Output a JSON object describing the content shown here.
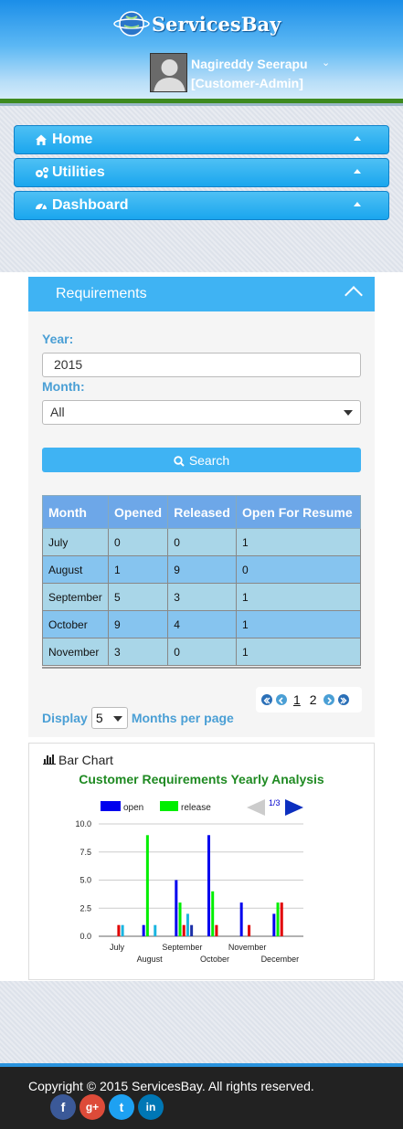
{
  "header": {
    "brand": "ServicesBay",
    "user_name": "Nagireddy Seerapu",
    "user_role": "[Customer-Admin]"
  },
  "nav": {
    "items": [
      {
        "label": "Home",
        "icon": "home-icon"
      },
      {
        "label": "Utilities",
        "icon": "cogs-icon"
      },
      {
        "label": "Dashboard",
        "icon": "dashboard-icon"
      }
    ]
  },
  "requirements": {
    "title": "Requirements",
    "year_label": "Year:",
    "year_value": "2015",
    "month_label": "Month:",
    "month_value": "All",
    "search_label": "Search",
    "columns": [
      "Month",
      "Opened",
      "Released",
      "Open For Resume"
    ],
    "rows": [
      [
        "July",
        "0",
        "0",
        "1"
      ],
      [
        "August",
        "1",
        "9",
        "0"
      ],
      [
        "September",
        "5",
        "3",
        "1"
      ],
      [
        "October",
        "9",
        "4",
        "1"
      ],
      [
        "November",
        "3",
        "0",
        "1"
      ]
    ],
    "pager": {
      "pages": [
        "1",
        "2"
      ],
      "current": "1"
    },
    "display_label": "Display",
    "per_page_value": "5",
    "per_page_suffix": "Months per page"
  },
  "chart_panel": {
    "heading": "Bar Chart",
    "page_indicator": "1/3"
  },
  "chart_data": {
    "type": "bar",
    "title": "Customer Requirements Yearly Analysis",
    "categories": [
      "July",
      "August",
      "September",
      "October",
      "November",
      "December"
    ],
    "series": [
      {
        "name": "open",
        "color": "#0000ee",
        "values": [
          0,
          1,
          5,
          9,
          3,
          2
        ]
      },
      {
        "name": "release",
        "color": "#00ee00",
        "values": [
          0,
          9,
          3,
          4,
          0,
          3
        ]
      },
      {
        "name": "",
        "color": "#e00000",
        "values": [
          1,
          0,
          1,
          1,
          1,
          3
        ]
      },
      {
        "name": "",
        "color": "#1ab5e0",
        "values": [
          1,
          1,
          2,
          0,
          0,
          0
        ]
      },
      {
        "name": "",
        "color": "#1a2fa8",
        "values": [
          0,
          0,
          1,
          0,
          0,
          0
        ]
      }
    ],
    "yticks": [
      "0.0",
      "2.5",
      "5.0",
      "7.5",
      "10.0"
    ],
    "ylim": [
      0,
      10
    ],
    "legend_position": "top-left",
    "grid": true
  },
  "footer": {
    "copyright": "Copyright © 2015 ServicesBay. All rights reserved.",
    "social": [
      {
        "label": "f",
        "color": "#3b5998",
        "icon": "facebook-icon"
      },
      {
        "label": "g+",
        "color": "#dd4b39",
        "icon": "google-plus-icon"
      },
      {
        "label": "t",
        "color": "#1da1f2",
        "icon": "twitter-icon"
      },
      {
        "label": "in",
        "color": "#0077b5",
        "icon": "linkedin-icon"
      }
    ]
  }
}
